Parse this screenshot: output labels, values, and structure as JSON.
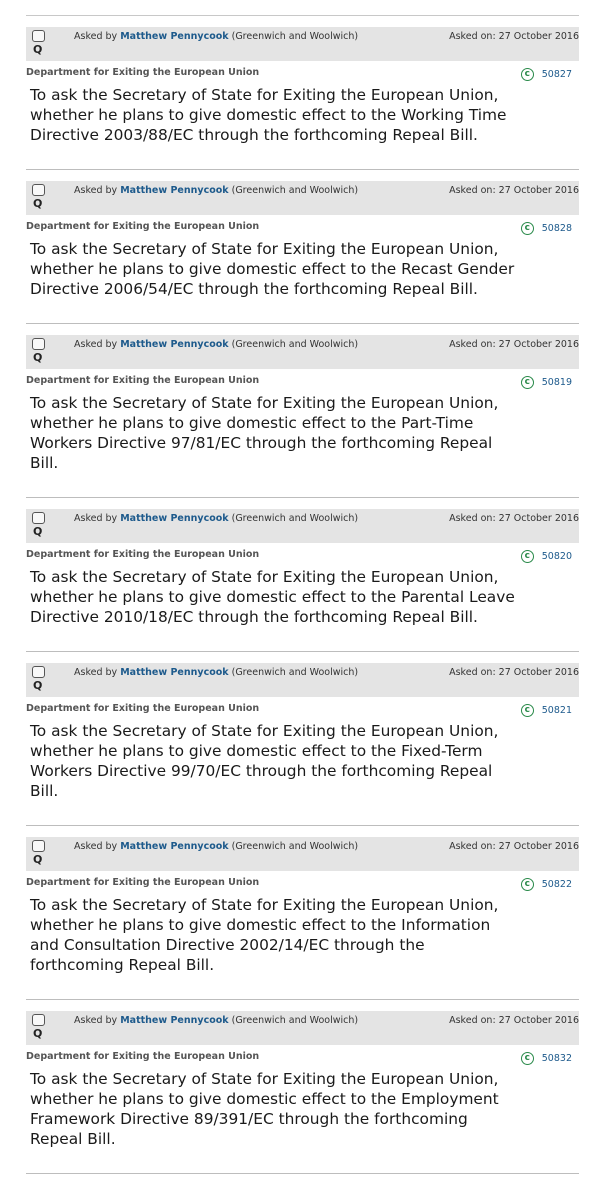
{
  "questions": [
    {
      "asked_by_prefix": "Asked by",
      "member": "Matthew Pennycook",
      "constituency": "(Greenwich and Woolwich)",
      "asked_on": "Asked on: 27 October 2016",
      "department": "Department for Exiting the European Union",
      "uin": "50827",
      "badge": "Q",
      "lines": [
        "To ask the Secretary of State for Exiting the European Union,",
        "whether he plans to give domestic effect to the Working Time",
        "Directive 2003/88/EC through the forthcoming Repeal Bill."
      ]
    },
    {
      "asked_by_prefix": "Asked by",
      "member": "Matthew Pennycook",
      "constituency": "(Greenwich and Woolwich)",
      "asked_on": "Asked on: 27 October 2016",
      "department": "Department for Exiting the European Union",
      "uin": "50828",
      "badge": "Q",
      "lines": [
        "To ask the Secretary of State for Exiting the European Union,",
        "whether he plans to give domestic effect to the Recast Gender",
        "Directive 2006/54/EC through the forthcoming Repeal Bill."
      ]
    },
    {
      "asked_by_prefix": "Asked by",
      "member": "Matthew Pennycook",
      "constituency": "(Greenwich and Woolwich)",
      "asked_on": "Asked on: 27 October 2016",
      "department": "Department for Exiting the European Union",
      "uin": "50819",
      "badge": "Q",
      "lines": [
        "To ask the Secretary of State for Exiting the European Union,",
        "whether he plans to give domestic effect to the Part-Time",
        "Workers Directive 97/81/EC through the forthcoming Repeal",
        "Bill."
      ]
    },
    {
      "asked_by_prefix": "Asked by",
      "member": "Matthew Pennycook",
      "constituency": "(Greenwich and Woolwich)",
      "asked_on": "Asked on: 27 October 2016",
      "department": "Department for Exiting the European Union",
      "uin": "50820",
      "badge": "Q",
      "lines": [
        "To ask the Secretary of State for Exiting the European Union,",
        "whether he plans to give domestic effect to the Parental Leave",
        "Directive 2010/18/EC through the forthcoming Repeal Bill."
      ]
    },
    {
      "asked_by_prefix": "Asked by",
      "member": "Matthew Pennycook",
      "constituency": "(Greenwich and Woolwich)",
      "asked_on": "Asked on: 27 October 2016",
      "department": "Department for Exiting the European Union",
      "uin": "50821",
      "badge": "Q",
      "lines": [
        "To ask the Secretary of State for Exiting the European Union,",
        "whether he plans to give domestic effect to the Fixed-Term",
        "Workers Directive 99/70/EC through the forthcoming Repeal",
        "Bill."
      ]
    },
    {
      "asked_by_prefix": "Asked by",
      "member": "Matthew Pennycook",
      "constituency": "(Greenwich and Woolwich)",
      "asked_on": "Asked on: 27 October 2016",
      "department": "Department for Exiting the European Union",
      "uin": "50822",
      "badge": "Q",
      "lines": [
        "To ask the Secretary of State for Exiting the European Union,",
        "whether he plans to give domestic effect to the Information",
        "and Consultation Directive 2002/14/EC through the",
        "forthcoming Repeal Bill."
      ]
    },
    {
      "asked_by_prefix": "Asked by",
      "member": "Matthew Pennycook",
      "constituency": "(Greenwich and Woolwich)",
      "asked_on": "Asked on: 27 October 2016",
      "department": "Department for Exiting the European Union",
      "uin": "50832",
      "badge": "Q",
      "lines": [
        "To ask the Secretary of State for Exiting the European Union,",
        "whether he plans to give domestic effect to the Employment",
        "Framework Directive 89/391/EC through the forthcoming",
        "Repeal Bill."
      ]
    }
  ],
  "colors": {
    "header_bg": "#e4e4e4",
    "member_link": "#1d5a8c",
    "uin_link": "#1d5a8c",
    "copyright_icon": "#2a8a4a",
    "department_text": "#555555"
  },
  "icons": {
    "badge_checkbox": "checkbox-icon",
    "uin_marker": "copyright-circle-icon"
  }
}
